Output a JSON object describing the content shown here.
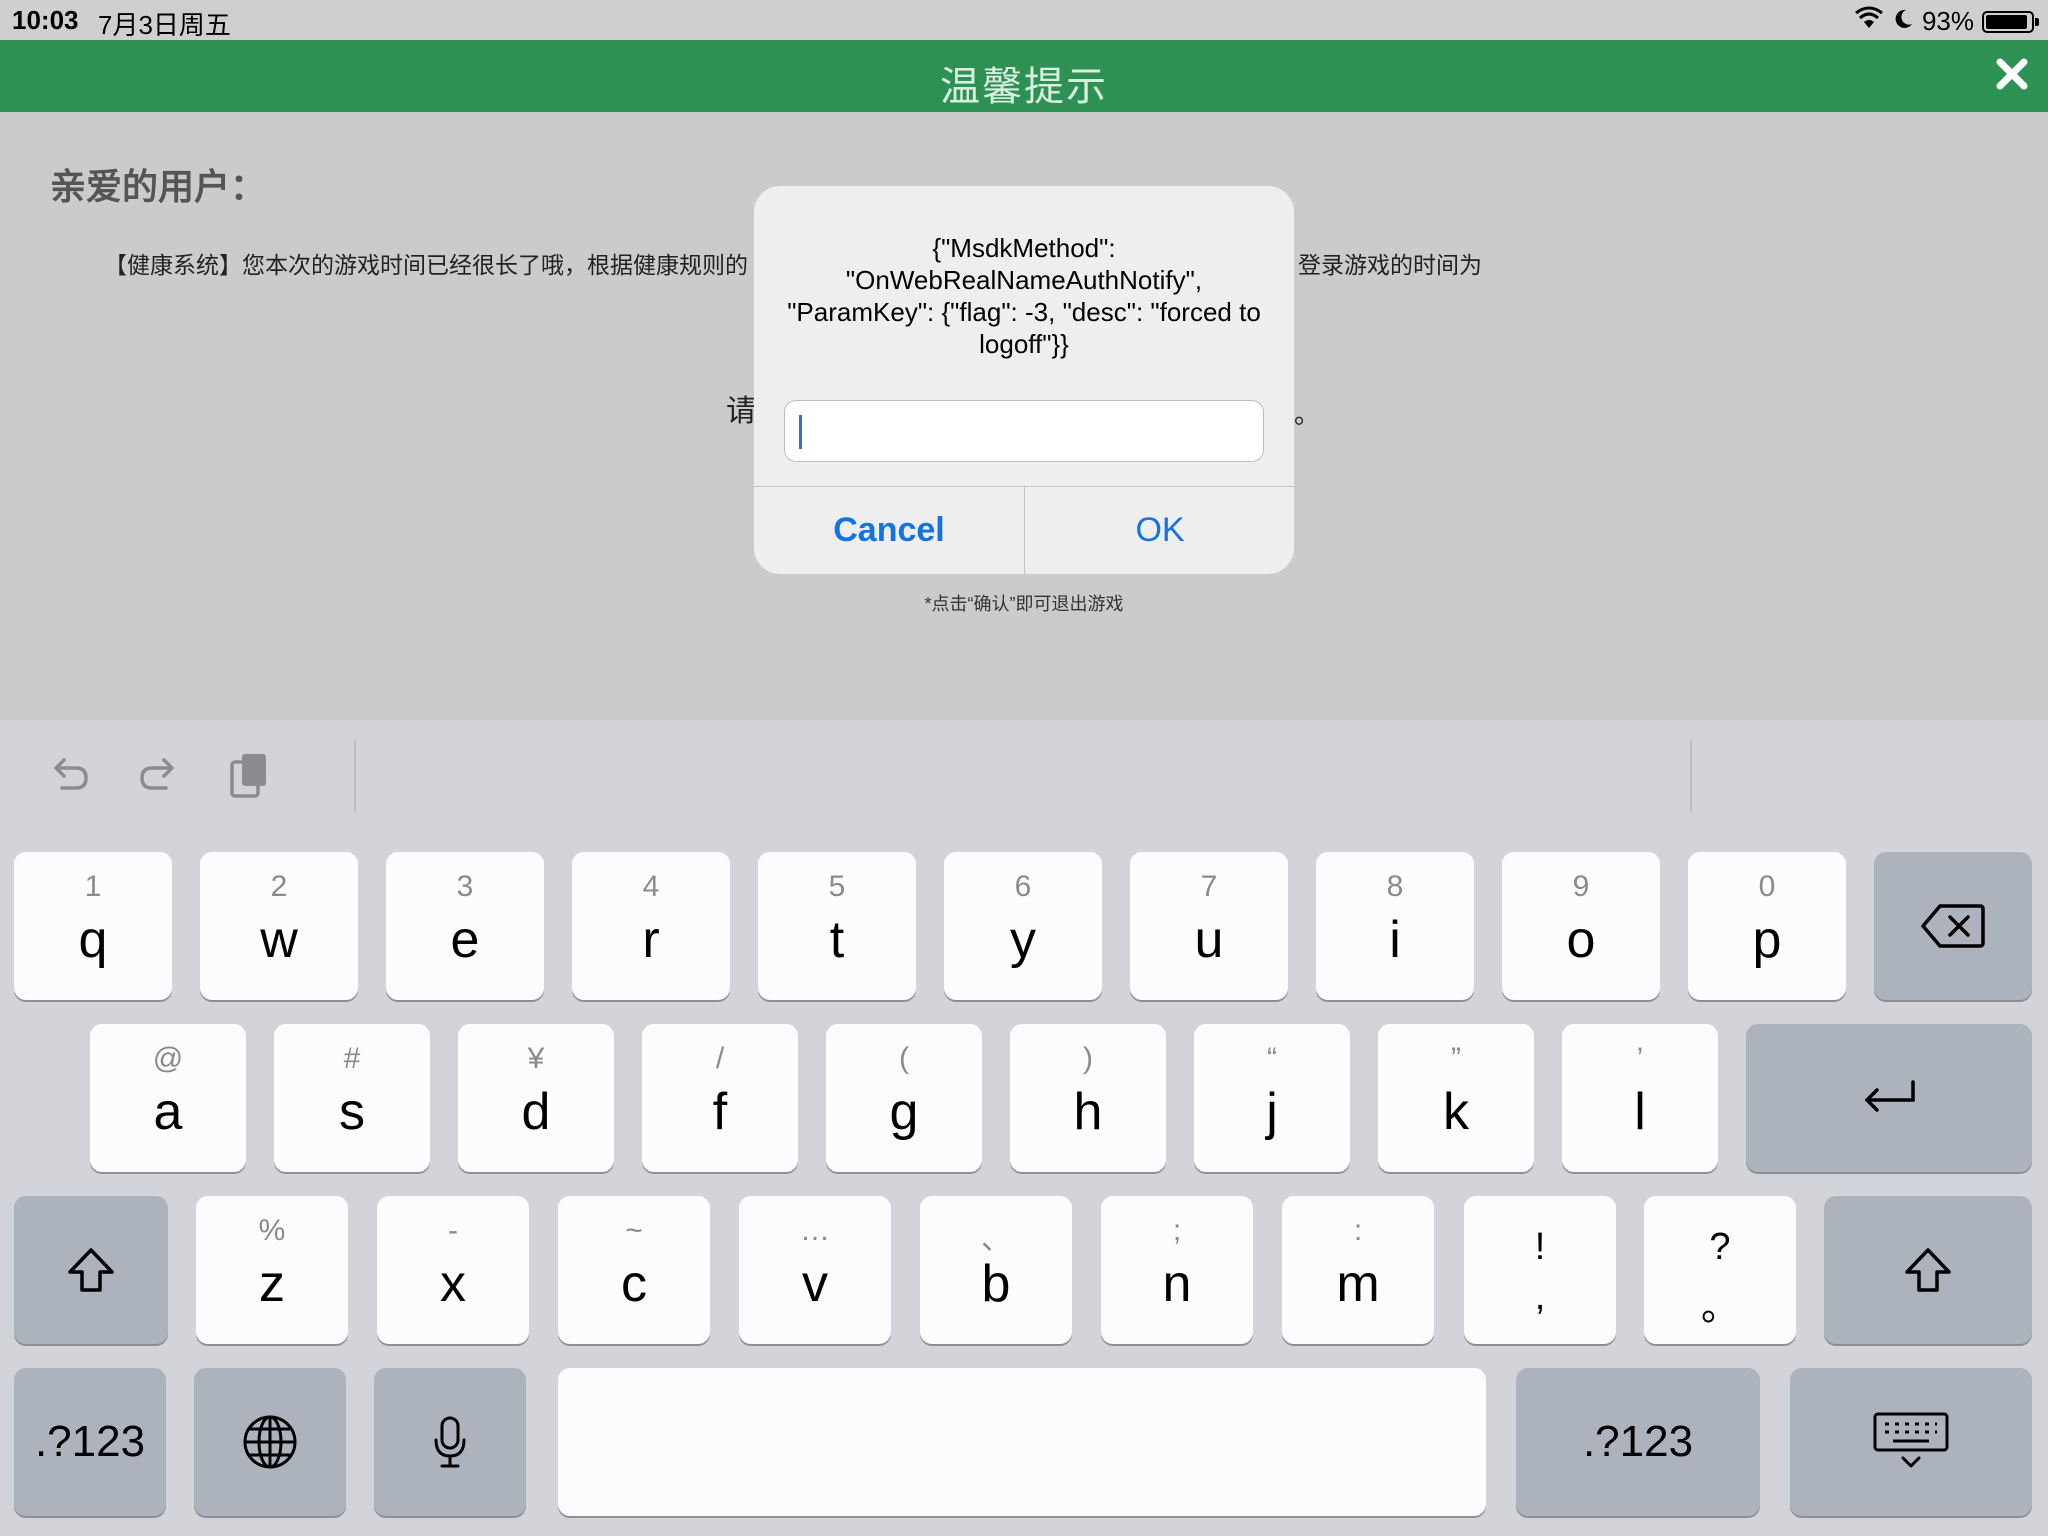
{
  "status_bar": {
    "time": "10:03",
    "date": "7月3日周五",
    "battery_percent": "93%",
    "battery_level": 0.93
  },
  "page": {
    "title": "温馨提示",
    "greeting": "亲爱的用户：",
    "notice_left": "【健康系统】您本次的游戏时间已经很长了哦，根据健康规则的",
    "notice_right": "登录游戏的时间为",
    "notice_mid_left": "请",
    "notice_mid_right": "。",
    "confirm_hint": "*点击“确认”即可退出游戏"
  },
  "alert": {
    "message": "{\"MsdkMethod\": \"OnWebRealNameAuthNotify\", \"ParamKey\": {\"flag\": -3, \"desc\": \"forced to logoff\"}}",
    "input_value": "",
    "cancel_label": "Cancel",
    "ok_label": "OK"
  },
  "keyboard": {
    "row1": [
      {
        "hint": "1",
        "main": "q"
      },
      {
        "hint": "2",
        "main": "w"
      },
      {
        "hint": "3",
        "main": "e"
      },
      {
        "hint": "4",
        "main": "r"
      },
      {
        "hint": "5",
        "main": "t"
      },
      {
        "hint": "6",
        "main": "y"
      },
      {
        "hint": "7",
        "main": "u"
      },
      {
        "hint": "8",
        "main": "i"
      },
      {
        "hint": "9",
        "main": "o"
      },
      {
        "hint": "0",
        "main": "p"
      }
    ],
    "row2": [
      {
        "hint": "@",
        "main": "a"
      },
      {
        "hint": "#",
        "main": "s"
      },
      {
        "hint": "¥",
        "main": "d"
      },
      {
        "hint": "/",
        "main": "f"
      },
      {
        "hint": "(",
        "main": "g"
      },
      {
        "hint": ")",
        "main": "h"
      },
      {
        "hint": "“",
        "main": "j"
      },
      {
        "hint": "”",
        "main": "k"
      },
      {
        "hint": "’",
        "main": "l"
      }
    ],
    "row3": [
      {
        "hint": "%",
        "main": "z"
      },
      {
        "hint": "-",
        "main": "x"
      },
      {
        "hint": "~",
        "main": "c"
      },
      {
        "hint": "…",
        "main": "v"
      },
      {
        "hint": "、",
        "main": "b"
      },
      {
        "hint": ";",
        "main": "n"
      },
      {
        "hint": ":",
        "main": "m"
      }
    ],
    "exclaim_top": "!",
    "exclaim_bottom": ",",
    "question_top": "?",
    "question_bottom": "。",
    "numbers_left": ".?123",
    "numbers_right": ".?123"
  },
  "icons": {
    "close": "close-icon",
    "wifi": "wifi-icon",
    "moon": "moon-icon",
    "undo": "undo-icon",
    "redo": "redo-icon",
    "paste": "paste-icon",
    "backspace": "backspace-icon",
    "return": "return-icon",
    "shift": "shift-icon",
    "globe": "globe-icon",
    "mic": "microphone-icon",
    "hide_keyboard": "hide-keyboard-icon"
  }
}
